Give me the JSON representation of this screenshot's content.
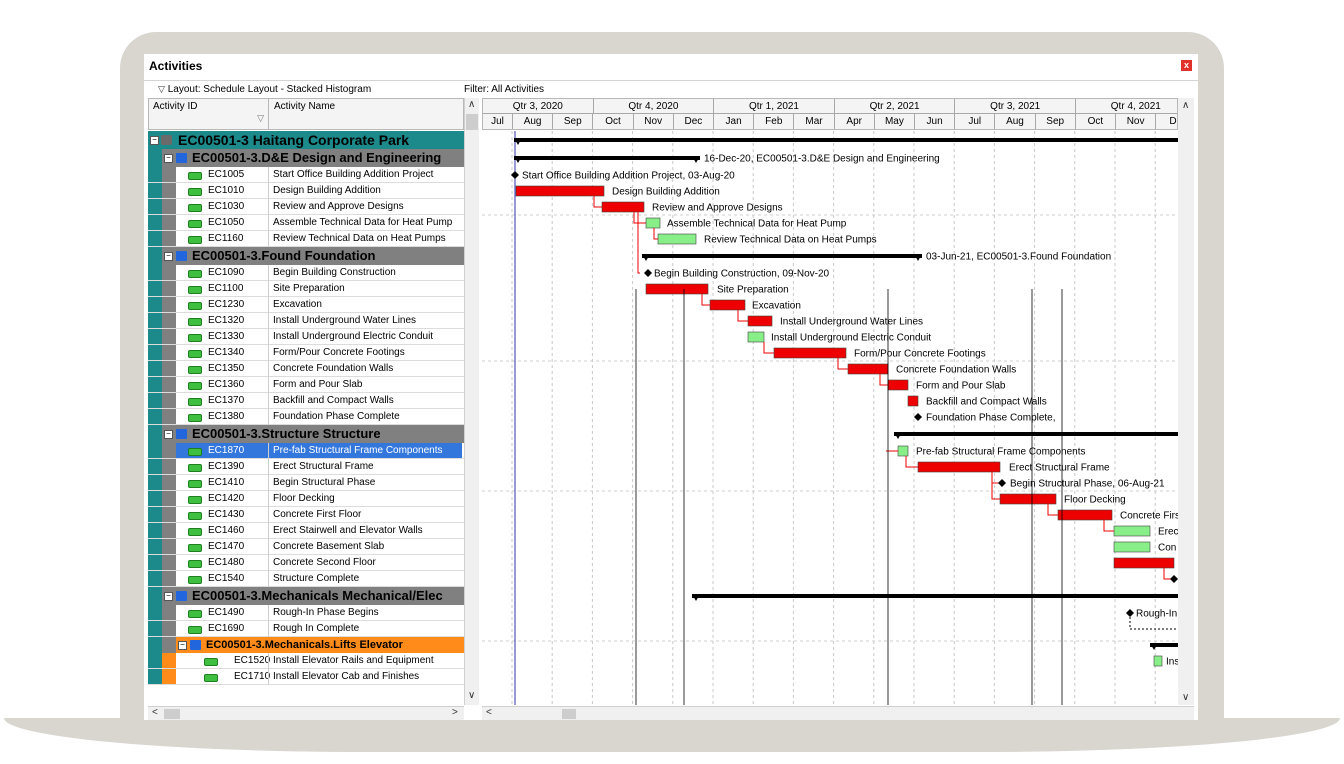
{
  "window": {
    "title": "Activities"
  },
  "layout_label": "Layout: Schedule Layout - Stacked Histogram",
  "filter_label": "Filter: All Activities",
  "columns": {
    "activity_id": "Activity ID",
    "activity_name": "Activity Name"
  },
  "timescale": {
    "quarters": [
      "Qtr 3, 2020",
      "Qtr 4, 2020",
      "Qtr 1, 2021",
      "Qtr 2, 2021",
      "Qtr 3, 2021",
      "Qtr 4, 2021"
    ],
    "months": [
      "Jul",
      "Aug",
      "Sep",
      "Oct",
      "Nov",
      "Dec",
      "Jan",
      "Feb",
      "Mar",
      "Apr",
      "May",
      "Jun",
      "Jul",
      "Aug",
      "Sep",
      "Oct",
      "Nov",
      "De"
    ]
  },
  "rows": [
    {
      "type": "project",
      "id": "EC00501-3",
      "name": "Haitang Corporate Park"
    },
    {
      "type": "wbs",
      "label": "EC00501-3.D&E  Design and Engineering"
    },
    {
      "type": "activity",
      "id": "EC1005",
      "name": "Start Office Building Addition Project"
    },
    {
      "type": "activity",
      "id": "EC1010",
      "name": "Design Building Addition"
    },
    {
      "type": "activity",
      "id": "EC1030",
      "name": "Review and Approve Designs"
    },
    {
      "type": "activity",
      "id": "EC1050",
      "name": "Assemble Technical Data for Heat Pump"
    },
    {
      "type": "activity",
      "id": "EC1160",
      "name": "Review Technical Data on Heat Pumps"
    },
    {
      "type": "wbs",
      "label": "EC00501-3.Found  Foundation"
    },
    {
      "type": "activity",
      "id": "EC1090",
      "name": "Begin Building Construction"
    },
    {
      "type": "activity",
      "id": "EC1100",
      "name": "Site Preparation"
    },
    {
      "type": "activity",
      "id": "EC1230",
      "name": "Excavation"
    },
    {
      "type": "activity",
      "id": "EC1320",
      "name": "Install Underground Water Lines"
    },
    {
      "type": "activity",
      "id": "EC1330",
      "name": "Install Underground Electric Conduit"
    },
    {
      "type": "activity",
      "id": "EC1340",
      "name": "Form/Pour Concrete Footings"
    },
    {
      "type": "activity",
      "id": "EC1350",
      "name": "Concrete Foundation Walls"
    },
    {
      "type": "activity",
      "id": "EC1360",
      "name": "Form and Pour Slab"
    },
    {
      "type": "activity",
      "id": "EC1370",
      "name": "Backfill and Compact Walls"
    },
    {
      "type": "activity",
      "id": "EC1380",
      "name": "Foundation Phase Complete"
    },
    {
      "type": "wbs",
      "label": "EC00501-3.Structure  Structure"
    },
    {
      "type": "activity",
      "id": "EC1870",
      "name": "Pre-fab Structural Frame Components",
      "selected": true
    },
    {
      "type": "activity",
      "id": "EC1390",
      "name": "Erect Structural Frame"
    },
    {
      "type": "activity",
      "id": "EC1410",
      "name": "Begin Structural Phase"
    },
    {
      "type": "activity",
      "id": "EC1420",
      "name": "Floor Decking"
    },
    {
      "type": "activity",
      "id": "EC1430",
      "name": "Concrete First Floor"
    },
    {
      "type": "activity",
      "id": "EC1460",
      "name": "Erect Stairwell and Elevator Walls"
    },
    {
      "type": "activity",
      "id": "EC1470",
      "name": "Concrete Basement Slab"
    },
    {
      "type": "activity",
      "id": "EC1480",
      "name": "Concrete Second Floor"
    },
    {
      "type": "activity",
      "id": "EC1540",
      "name": "Structure Complete"
    },
    {
      "type": "wbs",
      "label": "EC00501-3.Mechanicals  Mechanical/Elec"
    },
    {
      "type": "activity",
      "id": "EC1490",
      "name": "Rough-In Phase Begins"
    },
    {
      "type": "activity",
      "id": "EC1690",
      "name": "Rough In Complete"
    },
    {
      "type": "wbs2",
      "label": "EC00501-3.Mechanicals.Lifts  Elevator"
    },
    {
      "type": "activity2",
      "id": "EC1520",
      "name": "Install Elevator Rails and Equipment"
    },
    {
      "type": "activity2",
      "id": "EC1710",
      "name": "Install Elevator Cab and Finishes"
    }
  ],
  "gantt_labels": [
    "16-Dec-20, EC00501-3.D&E  Design and Engineering",
    "Start Office Building Addition Project, 03-Aug-20",
    "Design Building Addition",
    "Review and Approve Designs",
    "Assemble Technical Data for Heat Pump",
    "Review Technical Data on Heat Pumps",
    "03-Jun-21, EC00501-3.Found  Foundation",
    "Begin Building Construction, 09-Nov-20",
    "Site Preparation",
    "Excavation",
    "Install Underground Water Lines",
    "Install Underground Electric Conduit",
    "Form/Pour Concrete Footings",
    "Concrete Foundation Walls",
    "Form and Pour Slab",
    "Backfill and Compact Walls",
    "Foundation Phase Complete,",
    "Pre-fab Structural Frame Components",
    "Erect Structural Frame",
    "Begin Structural Phase, 06-Aug-21",
    "Floor Decking",
    "Concrete Firs",
    "Erec",
    "Con",
    "Rough-In",
    "Ins"
  ],
  "colors": {
    "project_band": "#1c8a8a",
    "wbs_band": "#808080",
    "lift_band": "#ff8c1a",
    "selected_row": "#3377dd",
    "critical_bar": "#ee0000",
    "normal_bar": "#88ee88",
    "summary_bar": "#000000"
  }
}
